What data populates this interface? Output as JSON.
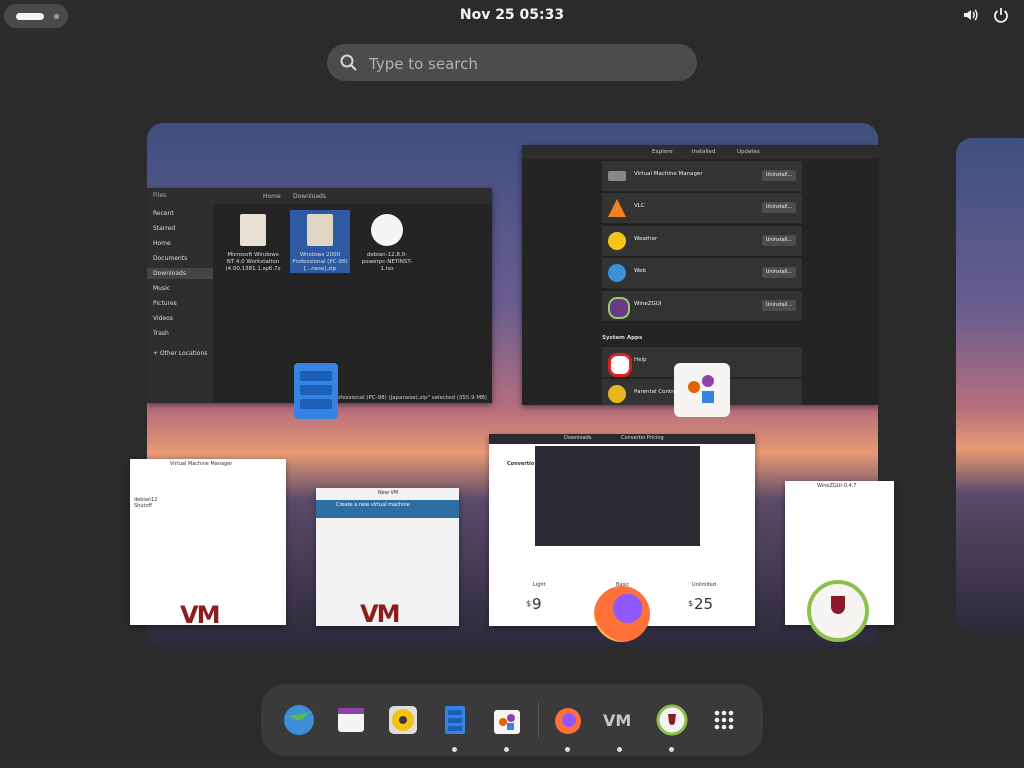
{
  "top_bar": {
    "clock": "Nov 25  05:33",
    "icons": [
      "volume-icon",
      "power-icon"
    ]
  },
  "search": {
    "placeholder": "Type to search"
  },
  "files_window": {
    "header": {
      "back": "",
      "location_parent": "Home",
      "location": "Downloads"
    },
    "title": "Files",
    "sidebar": [
      "Recent",
      "Starred",
      "Home",
      "Documents",
      "Downloads",
      "Music",
      "Pictures",
      "Videos",
      "Trash",
      "+ Other Locations"
    ],
    "files": [
      {
        "name": "Microsoft Windows NT 4.0 Workstation (4.00.1381.1.sp6.7z"
      },
      {
        "name": "Windows 2000 Professional (PC-98) [...nese].zip"
      },
      {
        "name": "debian-12.8.0-powerpc-NETINST-1.iso"
      }
    ],
    "status": "Professional (PC-98) (Japanese).zip\" selected (355.9 MB)"
  },
  "software_window": {
    "tabs": [
      "Explore",
      "Installed",
      "Updates"
    ],
    "apps": [
      {
        "name": "Virtual Machine Manager",
        "button": "Uninstall..."
      },
      {
        "name": "VLC",
        "button": "Uninstall..."
      },
      {
        "name": "Weather",
        "button": "Uninstall..."
      },
      {
        "name": "Web",
        "button": "Uninstall..."
      },
      {
        "name": "WineZGUI",
        "button": "Uninstall..."
      }
    ],
    "section": "System Apps",
    "system_apps": [
      {
        "name": "Help"
      },
      {
        "name": "Parental Controls"
      }
    ]
  },
  "virt_window": {
    "title": "Virtual Machine Manager",
    "vm": "debian12 Shutoff"
  },
  "newvm_window": {
    "title": "New VM",
    "heading": "Create a new virtual machine"
  },
  "firefox_window": {
    "tabs": [
      "Downloads",
      "Convertio Pricing"
    ],
    "brand": "Convertio",
    "prices": [
      "9",
      "25"
    ],
    "currency": "$",
    "plan_labels": [
      "Light",
      "Basic",
      "Unlimited"
    ]
  },
  "wine_window": {
    "title": "WineZGUI-0.4.7"
  },
  "dash": {
    "apps": [
      {
        "name": "web-browser-icon",
        "running": false
      },
      {
        "name": "calendar-icon",
        "running": false
      },
      {
        "name": "rhythmbox-icon",
        "running": false
      },
      {
        "name": "files-icon",
        "running": true
      },
      {
        "name": "software-icon",
        "running": true
      },
      {
        "name": "firefox-icon",
        "running": true
      },
      {
        "name": "virt-manager-icon",
        "running": true
      },
      {
        "name": "winezgui-icon",
        "running": true
      },
      {
        "name": "app-grid-icon",
        "running": false
      }
    ]
  }
}
